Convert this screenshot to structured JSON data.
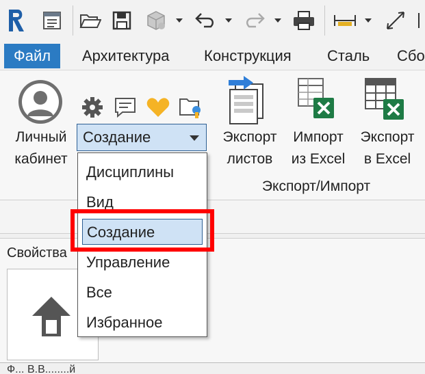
{
  "quick_access": {
    "icons": [
      "revit-logo-icon",
      "open-file-icon",
      "save-icon",
      "sync-icon",
      "undo-icon",
      "redo-icon",
      "print-icon",
      "measure-icon",
      "dimension-icon"
    ]
  },
  "tabs": [
    {
      "label": "Файл",
      "active": true
    },
    {
      "label": "Архитектура"
    },
    {
      "label": "Конструкция"
    },
    {
      "label": "Сталь"
    },
    {
      "label": "Сбо"
    }
  ],
  "ribbon": {
    "account_label_1": "Личный",
    "account_label_2": "кабинет",
    "dropdown_value": "Создание",
    "export_sheets_1": "Экспорт",
    "export_sheets_2": "листов",
    "import_excel_1": "Импорт",
    "import_excel_2": "из Excel",
    "export_excel_1": "Экспорт",
    "export_excel_2": "в Excel",
    "group_label": "Экспорт/Импорт"
  },
  "dropdown_menu": {
    "items": [
      "Дисциплины",
      "Вид",
      "Создание",
      "Управление",
      "Все",
      "Избранное"
    ],
    "selected": "Создание"
  },
  "properties": {
    "title": "Свойства",
    "type_text": "Ф... В.В........й"
  },
  "colors": {
    "accent": "#2b7bc3",
    "highlight": "#ff0000",
    "selection": "#cfe2f5",
    "excel_green": "#1e7b45"
  }
}
